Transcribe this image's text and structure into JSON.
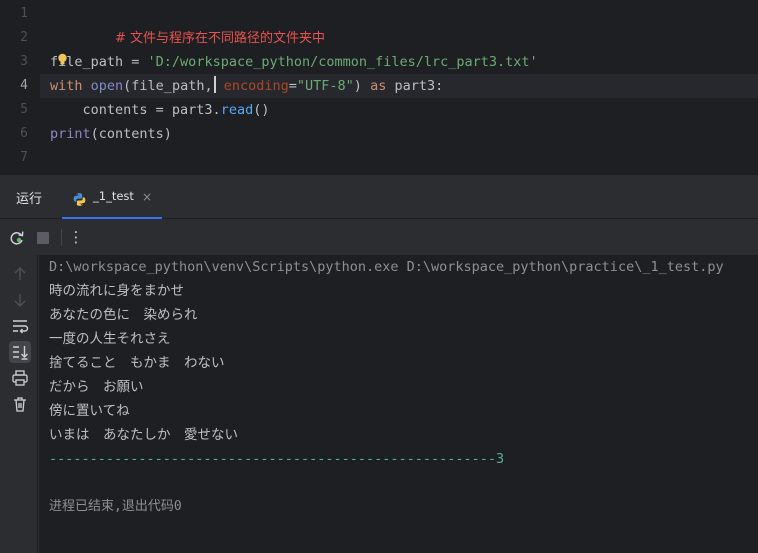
{
  "editor": {
    "line_numbers": [
      "1",
      "2",
      "3",
      "4",
      "5",
      "6",
      "7"
    ],
    "active_line": "4",
    "line1_comment": "# 文件与程序在不同路径的文件夹中",
    "line3_var": "file_path",
    "line3_eq": " = ",
    "line3_str": "'D:/workspace_python/common_files/lrc_part3.txt'",
    "line4_with": "with",
    "line4_open": "open",
    "line4_paren_open": "(file_path,",
    "line4_param": "encoding",
    "line4_eq": "=",
    "line4_str": "\"UTF-8\"",
    "line4_close": ") ",
    "line4_as": "as",
    "line4_alias": " part3:",
    "line5_indent": "    contents = part3.",
    "line5_method": "read",
    "line5_tail": "()",
    "line6_print": "print",
    "line6_args": "(contents)"
  },
  "run_window": {
    "title": "运行",
    "tab_label": "_1_test",
    "tab_close": "×",
    "tab_icon": "python-icon",
    "toolbar_more": "⋮"
  },
  "console": {
    "command": "D:\\workspace_python\\venv\\Scripts\\python.exe D:\\workspace_python\\practice\\_1_test.py",
    "lines": [
      "時の流れに身をまかせ",
      "あなたの色に　染められ",
      "一度の人生それさえ",
      "捨てること　もかま　わない",
      "だから　お願い",
      "傍に置いてね",
      "いまは　あなたしか　愛せない"
    ],
    "dashes": "-------------------------------------------------------3",
    "exit_message": "进程已结束,退出代码0"
  },
  "colors": {
    "editor_bg": "#1e1f22",
    "panel_bg": "#2b2d30",
    "comment": "#e8534f",
    "string": "#6aab73",
    "keyword": "#cf8e6d",
    "accent": "#3574f0"
  }
}
